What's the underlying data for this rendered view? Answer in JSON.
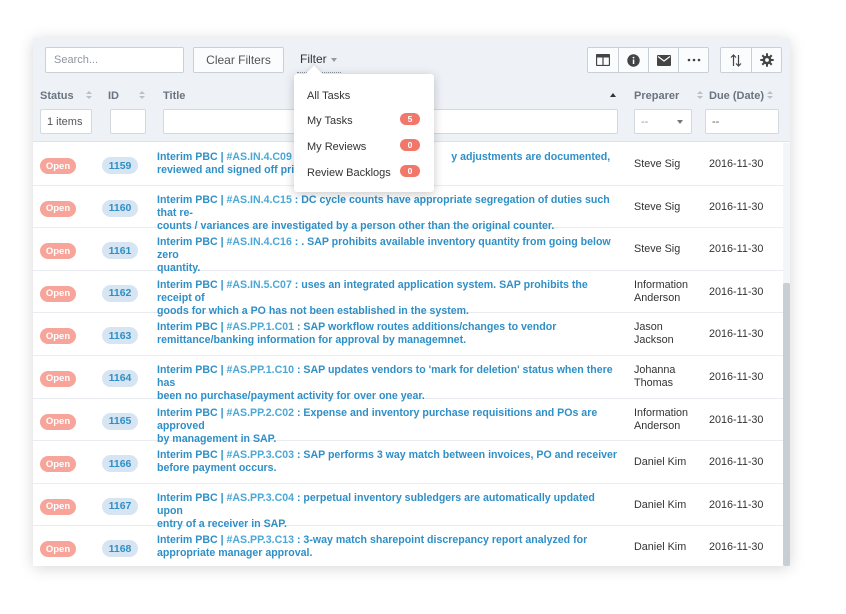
{
  "toolbar": {
    "search_placeholder": "Search...",
    "clear_filters_label": "Clear Filters",
    "filter_label": "Filter",
    "icons": [
      "table-view-icon",
      "info-icon",
      "mail-icon",
      "more-icon",
      "sort-icon",
      "gear-icon"
    ]
  },
  "filter_menu": {
    "items": [
      {
        "label": "All Tasks",
        "count": ""
      },
      {
        "label": "My Tasks",
        "count": "5"
      },
      {
        "label": "My Reviews",
        "count": "0"
      },
      {
        "label": "Review Backlogs",
        "count": "0"
      }
    ]
  },
  "columns": {
    "status": "Status",
    "id": "ID",
    "title": "Title",
    "preparer": "Preparer",
    "due": "Due (Date)"
  },
  "column_filters": {
    "status_value": "1 items",
    "preparer_value": "--",
    "due_value": "--"
  },
  "colors": {
    "accent": "#2f8fc7",
    "open_badge": "#f7a49a",
    "count_badge": "#f0776a",
    "header_bg": "#eef2f7"
  },
  "rows": [
    {
      "status": "Open",
      "id": "1159",
      "prefix": "Interim PBC | ",
      "code": "#AS.IN.4.C09",
      "line1": " : ",
      "hidden_mid": "",
      "line1_tail": "y adjustments are documented,",
      "line2": "reviewed and signed off prior",
      "preparer": "Steve Sig",
      "due": "2016-11-30"
    },
    {
      "status": "Open",
      "id": "1160",
      "prefix": "Interim PBC | ",
      "code": "#AS.IN.4.C15",
      "line1": " : DC cycle counts have appropriate segregation of duties such that re-",
      "hidden_mid": "",
      "line1_tail": "",
      "line2": "counts / variances are investigated by a person other than the original counter.",
      "preparer": "Steve Sig",
      "due": "2016-11-30"
    },
    {
      "status": "Open",
      "id": "1161",
      "prefix": "Interim PBC | ",
      "code": "#AS.IN.4.C16",
      "line1": " : . SAP prohibits available inventory quantity from going below zero",
      "hidden_mid": "",
      "line1_tail": "",
      "line2": "quantity.",
      "preparer": "Steve Sig",
      "due": "2016-11-30"
    },
    {
      "status": "Open",
      "id": "1162",
      "prefix": "Interim PBC | ",
      "code": "#AS.IN.5.C07",
      "line1": " : uses an integrated application system. SAP prohibits the receipt of",
      "hidden_mid": "",
      "line1_tail": "",
      "line2": "goods for which a PO has not been established in the system.",
      "preparer": "Information Anderson",
      "due": "2016-11-30"
    },
    {
      "status": "Open",
      "id": "1163",
      "prefix": "Interim PBC | ",
      "code": "#AS.PP.1.C01",
      "line1": " : SAP workflow routes additions/changes to vendor",
      "hidden_mid": "",
      "line1_tail": "",
      "line2": "remittance/banking information for approval by managemnet.",
      "preparer": "Jason Jackson",
      "due": "2016-11-30"
    },
    {
      "status": "Open",
      "id": "1164",
      "prefix": "Interim PBC | ",
      "code": "#AS.PP.1.C10",
      "line1": " : SAP updates vendors to 'mark for deletion' status when there has",
      "hidden_mid": "",
      "line1_tail": "",
      "line2": "been no purchase/payment activity for over one year.",
      "preparer": "Johanna Thomas",
      "due": "2016-11-30"
    },
    {
      "status": "Open",
      "id": "1165",
      "prefix": "Interim PBC | ",
      "code": "#AS.PP.2.C02",
      "line1": " : Expense and inventory purchase requisitions and POs are approved",
      "hidden_mid": "",
      "line1_tail": "",
      "line2": "by management in SAP.",
      "preparer": "Information Anderson",
      "due": "2016-11-30"
    },
    {
      "status": "Open",
      "id": "1166",
      "prefix": "Interim PBC | ",
      "code": "#AS.PP.3.C03",
      "line1": " : SAP performs 3 way match between invoices, PO and receiver",
      "hidden_mid": "",
      "line1_tail": "",
      "line2": "before payment occurs.",
      "preparer": "Daniel Kim",
      "due": "2016-11-30"
    },
    {
      "status": "Open",
      "id": "1167",
      "prefix": "Interim PBC | ",
      "code": "#AS.PP.3.C04",
      "line1": " : perpetual inventory subledgers are automatically updated upon",
      "hidden_mid": "",
      "line1_tail": "",
      "line2": "entry of a receiver in SAP.",
      "preparer": "Daniel Kim",
      "due": "2016-11-30"
    },
    {
      "status": "Open",
      "id": "1168",
      "prefix": "Interim PBC | ",
      "code": "#AS.PP.3.C13",
      "line1": " : 3-way match sharepoint discrepancy report analyzed for",
      "hidden_mid": "",
      "line1_tail": "",
      "line2": "appropriate manager approval.",
      "preparer": "Daniel Kim",
      "due": "2016-11-30"
    }
  ]
}
